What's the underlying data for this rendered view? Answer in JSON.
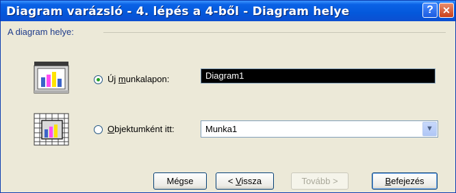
{
  "window": {
    "title": "Diagram varázsló - 4. lépés a 4-ből - Diagram helye",
    "help_glyph": "?",
    "close_glyph": "✕"
  },
  "group": {
    "label": "A diagram helye:"
  },
  "option_new_sheet": {
    "label_prefix": "Új ",
    "label_accel": "m",
    "label_rest": "unkalapon:",
    "value": "Diagram1",
    "selected": true
  },
  "option_object": {
    "label_accel": "O",
    "label_rest": "bjektumként itt:",
    "value": "Munka1",
    "selected": false,
    "arrow_glyph": "▼"
  },
  "buttons": {
    "cancel": "Mégse",
    "back_prefix": "< ",
    "back_accel": "V",
    "back_rest": "issza",
    "next": "Tovább >",
    "finish_accel": "B",
    "finish_rest": "efejezés"
  },
  "colors": {
    "titlebar": "#0458db",
    "dialog_bg": "#ece9d8",
    "group_label": "#1d3a8a",
    "radio_dot": "#21a121"
  }
}
